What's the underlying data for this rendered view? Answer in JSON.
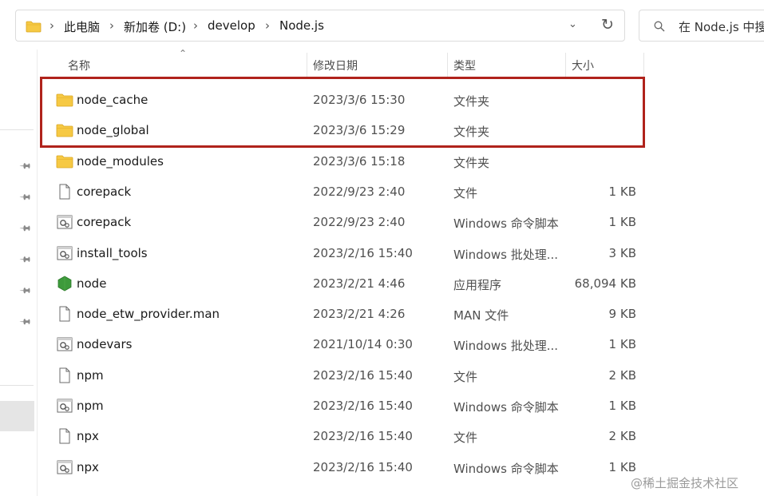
{
  "address_bar": {
    "crumbs": [
      "此电脑",
      "新加卷 (D:)",
      "develop",
      "Node.js"
    ],
    "separator": "›",
    "dropdown_icon": "chevron-down-icon",
    "refresh_icon": "refresh-icon"
  },
  "search": {
    "placeholder": "在 Node.js 中搜"
  },
  "columns": {
    "name": "名称",
    "modified": "修改日期",
    "type": "类型",
    "size": "大小"
  },
  "files": [
    {
      "name": "node_cache",
      "modified": "2023/3/6 15:30",
      "type": "文件夹",
      "size": "",
      "icon": "folder-icon"
    },
    {
      "name": "node_global",
      "modified": "2023/3/6 15:29",
      "type": "文件夹",
      "size": "",
      "icon": "folder-icon"
    },
    {
      "name": "node_modules",
      "modified": "2023/3/6 15:18",
      "type": "文件夹",
      "size": "",
      "icon": "folder-icon"
    },
    {
      "name": "corepack",
      "modified": "2022/9/23 2:40",
      "type": "文件",
      "size": "1 KB",
      "icon": "file-icon"
    },
    {
      "name": "corepack",
      "modified": "2022/9/23 2:40",
      "type": "Windows 命令脚本",
      "size": "1 KB",
      "icon": "script-icon"
    },
    {
      "name": "install_tools",
      "modified": "2023/2/16 15:40",
      "type": "Windows 批处理...",
      "size": "3 KB",
      "icon": "script-icon"
    },
    {
      "name": "node",
      "modified": "2023/2/21 4:46",
      "type": "应用程序",
      "size": "68,094 KB",
      "icon": "nodejs-icon"
    },
    {
      "name": "node_etw_provider.man",
      "modified": "2023/2/21 4:26",
      "type": "MAN 文件",
      "size": "9 KB",
      "icon": "file-icon"
    },
    {
      "name": "nodevars",
      "modified": "2021/10/14 0:30",
      "type": "Windows 批处理...",
      "size": "1 KB",
      "icon": "script-icon"
    },
    {
      "name": "npm",
      "modified": "2023/2/16 15:40",
      "type": "文件",
      "size": "2 KB",
      "icon": "file-icon"
    },
    {
      "name": "npm",
      "modified": "2023/2/16 15:40",
      "type": "Windows 命令脚本",
      "size": "1 KB",
      "icon": "script-icon"
    },
    {
      "name": "npx",
      "modified": "2023/2/16 15:40",
      "type": "文件",
      "size": "2 KB",
      "icon": "file-icon"
    },
    {
      "name": "npx",
      "modified": "2023/2/16 15:40",
      "type": "Windows 命令脚本",
      "size": "1 KB",
      "icon": "script-icon"
    }
  ],
  "watermark": "@稀土掘金技术社区",
  "colors": {
    "highlight_border": "#b0231c",
    "folder": "#f6c944",
    "node_green": "#3d9a3b"
  }
}
